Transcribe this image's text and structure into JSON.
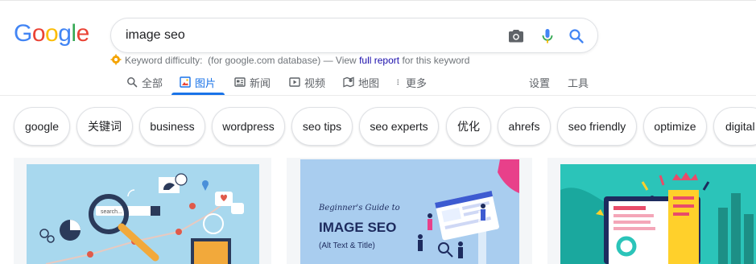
{
  "logo": {
    "letters": [
      "G",
      "o",
      "o",
      "g",
      "l",
      "e"
    ],
    "colors": [
      "#4285F4",
      "#EA4335",
      "#FBBC05",
      "#4285F4",
      "#34A853",
      "#EA4335"
    ]
  },
  "search": {
    "query": "image seo",
    "icons": [
      "camera-icon",
      "mic-icon",
      "search-icon"
    ]
  },
  "keyword_difficulty": {
    "label": "Keyword difficulty:",
    "database": "(for google.com database) — View",
    "link": "full report",
    "suffix": "for this keyword"
  },
  "tabs": [
    {
      "label": "全部",
      "icon": "search-icon"
    },
    {
      "label": "图片",
      "icon": "image-icon",
      "active": true
    },
    {
      "label": "新闻",
      "icon": "news-icon"
    },
    {
      "label": "视频",
      "icon": "video-icon"
    },
    {
      "label": "地图",
      "icon": "map-icon"
    },
    {
      "label": "更多",
      "icon": "more-icon"
    }
  ],
  "tools": {
    "settings": "设置",
    "tools": "工具"
  },
  "chips": [
    "google",
    "关键词",
    "business",
    "wordpress",
    "seo tips",
    "seo experts",
    "优化",
    "ahrefs",
    "seo friendly",
    "optimize",
    "digital"
  ],
  "results": {
    "card2": {
      "line1": "Beginner's Guide to",
      "line2": "IMAGE SEO",
      "line3": "(Alt Text & Title)"
    },
    "card1": {
      "search_word": "search..."
    }
  },
  "colors": {
    "accent": "#1a73e8",
    "link": "#1a0dab"
  }
}
